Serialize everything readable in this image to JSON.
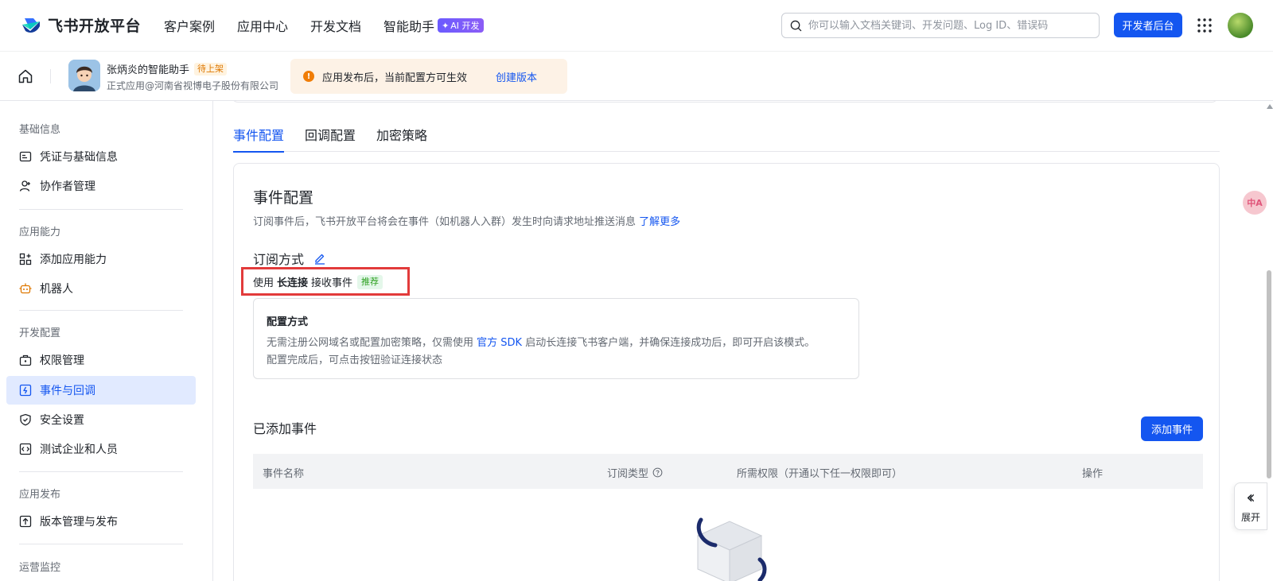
{
  "topnav": {
    "brand": "飞书开放平台",
    "links": [
      "客户案例",
      "应用中心",
      "开发文档",
      "智能助手"
    ],
    "ai_badge": "AI 开发",
    "search_placeholder": "你可以输入文档关键词、开发问题、Log ID、错误码",
    "dev_console_label": "开发者后台"
  },
  "appbar": {
    "app_name": "张炳炎的智能助手",
    "status": "待上架",
    "app_sub": "正式应用@河南省视博电子股份有限公司",
    "notice_text": "应用发布后，当前配置方可生效",
    "notice_link": "创建版本"
  },
  "sidebar": {
    "sections": [
      {
        "title": "基础信息",
        "items": [
          "凭证与基础信息",
          "协作者管理"
        ]
      },
      {
        "title": "应用能力",
        "items": [
          "添加应用能力",
          "机器人"
        ]
      },
      {
        "title": "开发配置",
        "items": [
          "权限管理",
          "事件与回调",
          "安全设置",
          "测试企业和人员"
        ]
      },
      {
        "title": "应用发布",
        "items": [
          "版本管理与发布"
        ]
      },
      {
        "title": "运营监控",
        "items": []
      }
    ],
    "active_item": "事件与回调"
  },
  "tabs": [
    "事件配置",
    "回调配置",
    "加密策略"
  ],
  "event_card": {
    "title": "事件配置",
    "desc": "订阅事件后，飞书开放平台将会在事件（如机器人入群）发生时向请求地址推送消息",
    "desc_link": "了解更多",
    "sub_title": "订阅方式",
    "mode_prefix": "使用",
    "mode_bold": "长连接",
    "mode_suffix": "接收事件",
    "mode_tag": "推荐",
    "config_title": "配置方式",
    "config_line1_a": "无需注册公网域名或配置加密策略，仅需使用",
    "config_line1_link": "官方 SDK",
    "config_line1_b": "启动长连接飞书客户端，并确保连接成功后，即可开启该模式。",
    "config_line2": "配置完成后，可点击按钮验证连接状态",
    "added_title": "已添加事件",
    "add_button": "添加事件",
    "table_headers": [
      "事件名称",
      "订阅类型",
      "所需权限（开通以下任一权限即可）",
      "操作"
    ]
  },
  "widgets": {
    "translate_label": "中A",
    "expand_label": "展开"
  },
  "colors": {
    "accent": "#1456f0",
    "highlight": "#e23b3b",
    "active_bg": "#e1eaff",
    "notice_bg": "#fdf2e6"
  }
}
